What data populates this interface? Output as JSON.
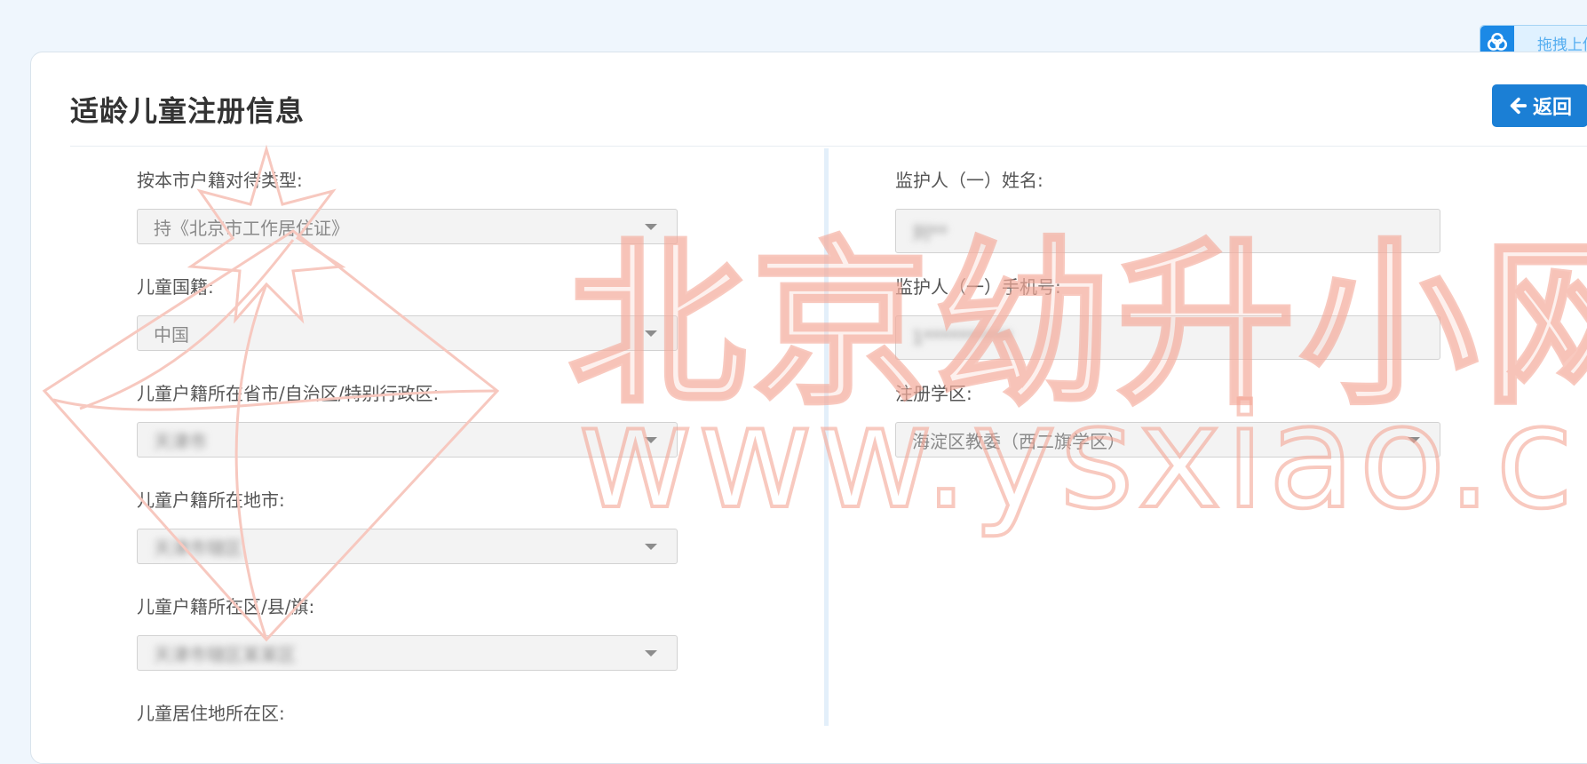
{
  "header": {
    "title": "适龄儿童注册信息",
    "back_label": "返回"
  },
  "widget": {
    "text": "拖拽上传"
  },
  "left_fields": [
    {
      "label": "按本市户籍对待类型:",
      "value": "持《北京市工作居住证》"
    },
    {
      "label": "儿童国籍:",
      "value": "中国"
    },
    {
      "label": "儿童户籍所在省市/自治区/特别行政区:",
      "value": "天津市"
    },
    {
      "label": "儿童户籍所在地市:",
      "value": "天津市辖区"
    },
    {
      "label": "儿童户籍所在区/县/旗:",
      "value": "天津市辖区某某区"
    },
    {
      "label": "儿童居住地所在区:",
      "value": ""
    }
  ],
  "right_fields": [
    {
      "label": "监护人（一）姓名:",
      "value": "刘**"
    },
    {
      "label": "监护人（一）手机号:",
      "value": "1**********"
    },
    {
      "label": "注册学区:",
      "value": "海淀区教委（西二旗学区）"
    }
  ],
  "watermark": {
    "title": "北京幼升小网",
    "url": "www.ysxiao.cn"
  },
  "colors": {
    "accent": "#1b7fd5",
    "background": "#eff6fd",
    "watermark": "#f7c8bf"
  }
}
